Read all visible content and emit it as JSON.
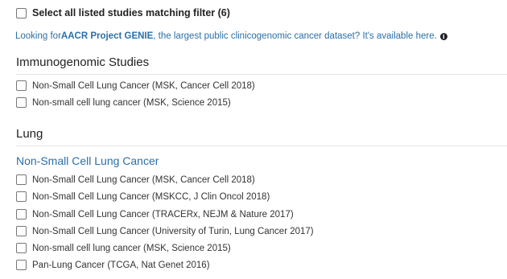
{
  "select_all": {
    "label": "Select all listed studies matching filter (6)"
  },
  "genie_banner": {
    "prefix": "Looking for ",
    "link": "AACR Project GENIE",
    "suffix": ", the largest public clinicogenomic cancer dataset?  It's available here.",
    "icon": "info-icon"
  },
  "sections": [
    {
      "title": "Immunogenomic Studies",
      "studies": [
        "Non-Small Cell Lung Cancer (MSK, Cancer Cell 2018)",
        "Non-small cell lung cancer (MSK, Science 2015)"
      ]
    },
    {
      "title": "Lung",
      "subtitle": "Non-Small Cell Lung Cancer",
      "studies": [
        "Non-Small Cell Lung Cancer (MSK, Cancer Cell 2018)",
        "Non-Small Cell Lung Cancer (MSKCC, J Clin Oncol 2018)",
        "Non-Small Cell Lung Cancer (TRACERx, NEJM & Nature 2017)",
        "Non-Small Cell Lung Cancer (University of Turin, Lung Cancer 2017)",
        "Non-small cell lung cancer (MSK, Science 2015)",
        "Pan-Lung Cancer (TCGA, Nat Genet 2016)"
      ]
    }
  ]
}
